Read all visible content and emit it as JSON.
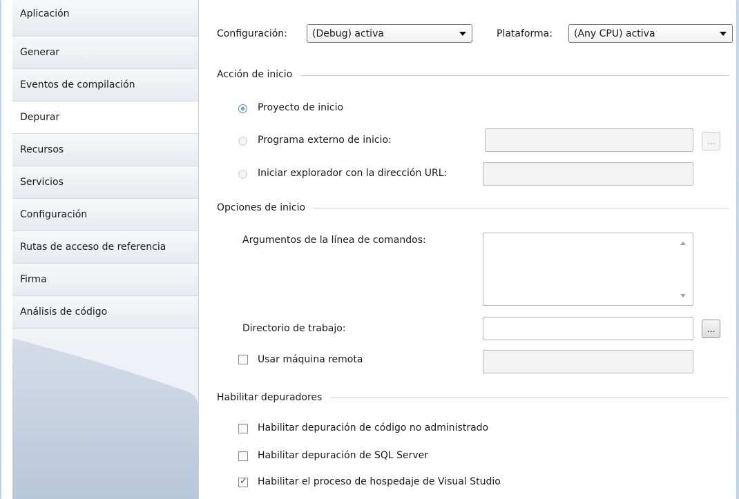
{
  "sidebar": {
    "items": [
      {
        "label": "Aplicación"
      },
      {
        "label": "Generar"
      },
      {
        "label": "Eventos de compilación"
      },
      {
        "label": "Depurar",
        "active": true
      },
      {
        "label": "Recursos"
      },
      {
        "label": "Servicios"
      },
      {
        "label": "Configuración"
      },
      {
        "label": "Rutas de acceso de referencia"
      },
      {
        "label": "Firma"
      },
      {
        "label": "Análisis de código"
      }
    ]
  },
  "toolbar": {
    "config_label": "Configuración:",
    "config_value": "(Debug) activa",
    "platform_label": "Plataforma:",
    "platform_value": "(Any CPU) activa"
  },
  "start_action": {
    "title": "Acción de inicio",
    "options": [
      {
        "label": "Proyecto de inicio",
        "checked": true
      },
      {
        "label": "Programa externo de inicio:",
        "checked": false
      },
      {
        "label": "Iniciar explorador con la dirección URL:",
        "checked": false
      }
    ],
    "browse_label": "..."
  },
  "start_options": {
    "title": "Opciones de inicio",
    "args_label": "Argumentos de la línea de comandos:",
    "args_value": "",
    "workdir_label": "Directorio de trabajo:",
    "workdir_value": "",
    "browse_label": "...",
    "remote_label": "Usar máquina remota",
    "remote_checked": false,
    "remote_value": ""
  },
  "debuggers": {
    "title": "Habilitar depuradores",
    "options": [
      {
        "label": "Habilitar depuración de código no administrado",
        "checked": false
      },
      {
        "label": "Habilitar depuración de SQL Server",
        "checked": false
      },
      {
        "label": "Habilitar el proceso de hospedaje de Visual Studio",
        "checked": true
      }
    ]
  },
  "colors": {
    "accent": "#1e5fae",
    "sidebar_bg": "#f1f3f6",
    "frame_glow": "#9fc0ea"
  }
}
